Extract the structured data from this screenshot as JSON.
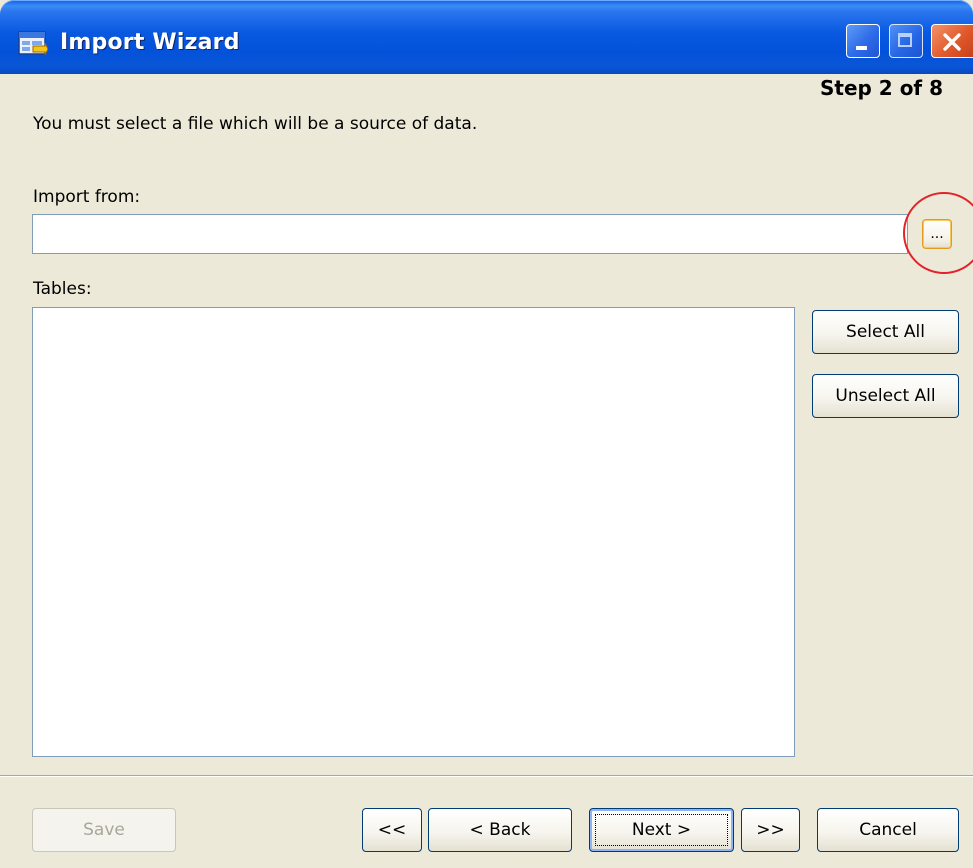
{
  "window": {
    "title": "Import Wizard",
    "icon": "wizard-app-icon"
  },
  "titlebar_buttons": {
    "minimize_icon": "minimize-icon",
    "maximize_icon": "maximize-icon",
    "close_icon": "close-icon"
  },
  "wizard": {
    "step_text": "Step 2 of 8",
    "instruction": "You must select a file which will be a source of data."
  },
  "import_from": {
    "label": "Import from:",
    "value": "",
    "browse_label": "...",
    "highlight_color": "#E2232A"
  },
  "tables": {
    "label": "Tables:",
    "items": []
  },
  "selection_buttons": {
    "select_all": "Select All",
    "unselect_all": "Unselect All"
  },
  "footer": {
    "save": "Save",
    "first": "<<",
    "back": "< Back",
    "next": "Next >",
    "last": ">>",
    "cancel": "Cancel"
  },
  "colors": {
    "titlebar": "#0858E0",
    "dialog_bg": "#ECE9D8",
    "close_button": "#E15A2C"
  }
}
